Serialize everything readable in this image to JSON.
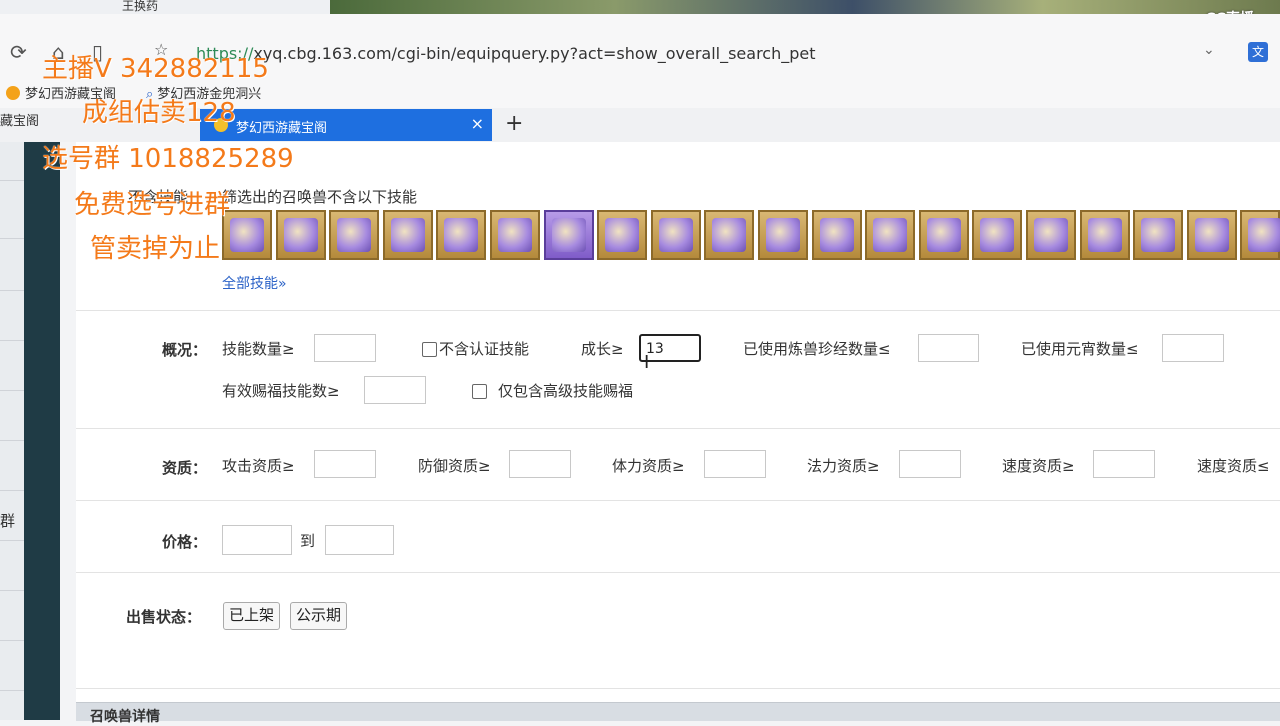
{
  "browser": {
    "prev_tab_title": "王换药",
    "brand": "CC直播",
    "url_protocol": "https://",
    "url_rest": "xyq.cbg.163.com/cgi-bin/equipquery.py?act=show_overall_search_pet",
    "bookmarks": [
      "梦幻西游藏宝阁",
      "梦幻西游金兜洞兴"
    ],
    "tab_left_title": "藏宝阁",
    "active_tab_title": "梦幻西游藏宝阁",
    "new_tab": "+",
    "close_tab": "×"
  },
  "sidebar": {
    "char": "群"
  },
  "skills": {
    "header_label": "不含技能：",
    "header_desc": "筛选出的召唤兽不含以下技能",
    "all_link": "全部技能»",
    "icons": [
      "skill-1",
      "skill-2",
      "skill-3",
      "skill-4",
      "skill-5",
      "skill-6",
      "skill-7",
      "skill-8",
      "skill-9",
      "skill-10",
      "skill-11",
      "skill-12",
      "skill-13",
      "skill-14",
      "skill-15",
      "skill-16",
      "skill-17",
      "skill-18",
      "skill-19",
      "skill-20"
    ]
  },
  "overview": {
    "label": "概况：",
    "skill_count": "技能数量≥",
    "no_certified": "不含认证技能",
    "growth": "成长≥",
    "growth_value": "13",
    "used_beast_books": "已使用炼兽珍经数量≤",
    "used_yuanxiao": "已使用元宵数量≤",
    "effective_blessing": "有效赐福技能数≥",
    "only_high_blessing": "仅包含高级技能赐福"
  },
  "aptitude": {
    "label": "资质：",
    "attack": "攻击资质≥",
    "defense": "防御资质≥",
    "hp": "体力资质≥",
    "magic": "法力资质≥",
    "speed_min": "速度资质≥",
    "speed_max": "速度资质≤"
  },
  "price": {
    "label": "价格：",
    "to": "到"
  },
  "sale": {
    "label": "出售状态：",
    "listed": "已上架",
    "public": "公示期"
  },
  "bottom": {
    "title": "召唤兽详情"
  },
  "overlay": {
    "line1": "主播V 342882115",
    "line2": "成组估卖128",
    "line3": "选号群 1018825289",
    "line4": "免费选号进群",
    "line5": "管卖掉为止"
  }
}
